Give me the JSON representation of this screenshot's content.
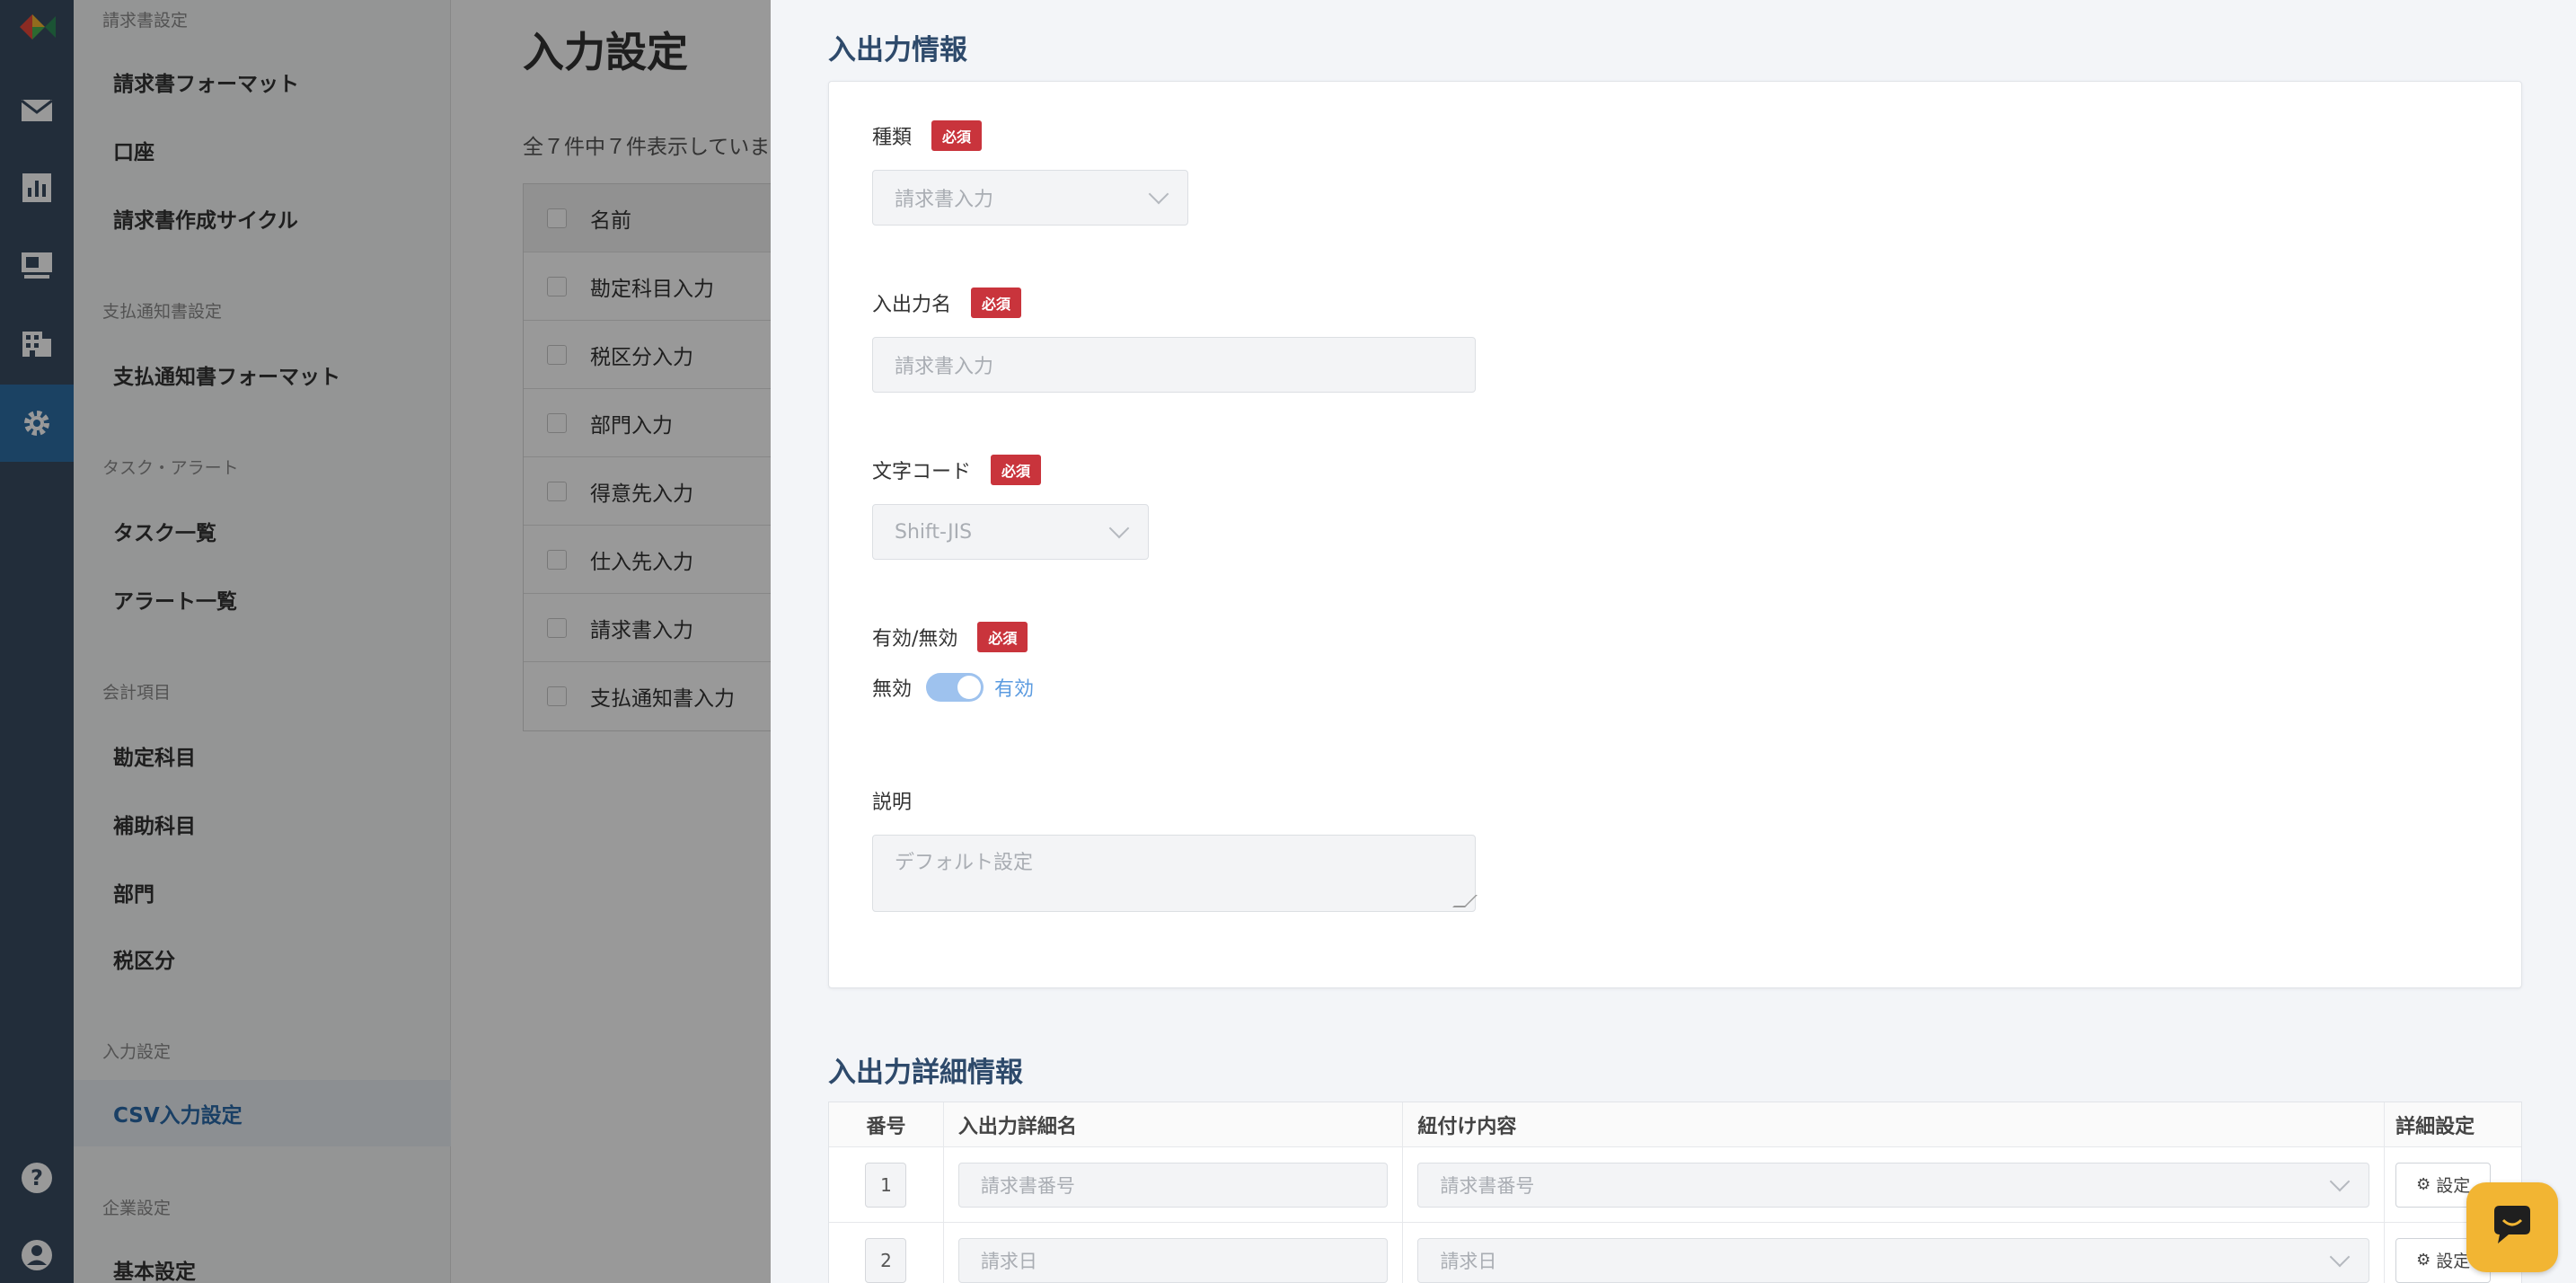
{
  "sidebar": {
    "sections": [
      {
        "title": "請求書設定",
        "items": [
          "請求書フォーマット",
          "口座",
          "請求書作成サイクル"
        ]
      },
      {
        "title": "支払通知書設定",
        "items": [
          "支払通知書フォーマット"
        ]
      },
      {
        "title": "タスク・アラート",
        "items": [
          "タスク一覧",
          "アラート一覧"
        ]
      },
      {
        "title": "会計項目",
        "items": [
          "勘定科目",
          "補助科目",
          "部門",
          "税区分"
        ]
      },
      {
        "title": "入力設定",
        "items": [
          "CSV入力設定"
        ]
      },
      {
        "title": "企業設定",
        "items": [
          "基本設定"
        ]
      }
    ]
  },
  "main": {
    "title": "入力設定",
    "count_text": "全７件中７件表示していま",
    "table_header": "名前",
    "rows": [
      "勘定科目入力",
      "税区分入力",
      "部門入力",
      "得意先入力",
      "仕入先入力",
      "請求書入力",
      "支払通知書入力"
    ]
  },
  "drawer": {
    "section1_title": "入出力情報",
    "required_label": "必須",
    "type_label": "種類",
    "type_value": "請求書入力",
    "name_label": "入出力名",
    "name_placeholder": "請求書入力",
    "encoding_label": "文字コード",
    "encoding_value": "Shift-JIS",
    "enabled_label": "有効/無効",
    "toggle_off": "無効",
    "toggle_on": "有効",
    "description_label": "説明",
    "description_placeholder": "デフォルト設定",
    "section2_title": "入出力詳細情報",
    "detail_headers": [
      "番号",
      "入出力詳細名",
      "紐付け内容",
      "詳細設定"
    ],
    "detail_rows": [
      {
        "num": "1",
        "name": "請求書番号",
        "mapping": "請求書番号",
        "button": "設定"
      },
      {
        "num": "2",
        "name": "請求日",
        "mapping": "請求日",
        "button": "設定"
      }
    ]
  },
  "colors": {
    "rail": "#3a4c62",
    "accent": "#2e6ea6",
    "required": "#c9343c",
    "chat": "#f2b533"
  },
  "icons": [
    "logo-icon",
    "mail-icon",
    "chart-icon",
    "monitor-icon",
    "building-icon",
    "gear-icon",
    "help-icon",
    "user-icon",
    "chat-icon"
  ]
}
